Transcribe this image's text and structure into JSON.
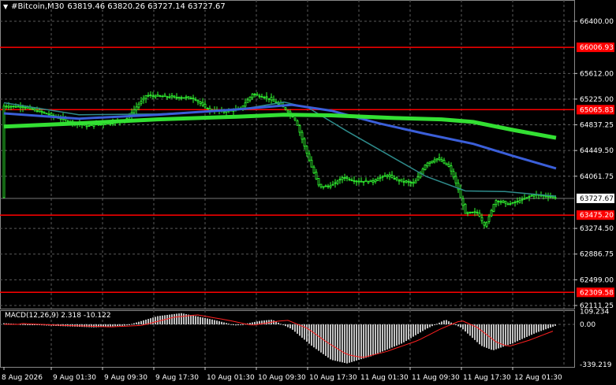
{
  "header": {
    "symbol": "#Bitcoin,M30",
    "ohlc": "63819.46 63820.26 63727.14 63727.67"
  },
  "price_axis": {
    "ticks": [
      "66400.00",
      "65612.00",
      "65225.00",
      "64837.25",
      "64449.50",
      "64061.75",
      "63274.50",
      "62886.75",
      "62499.00",
      "62111.25"
    ],
    "labels": [
      {
        "text": "66006.93",
        "kind": "level"
      },
      {
        "text": "65065.83",
        "kind": "level"
      },
      {
        "text": "63727.67",
        "kind": "current"
      },
      {
        "text": "63475.20",
        "kind": "level"
      },
      {
        "text": "62309.58",
        "kind": "level"
      }
    ]
  },
  "macd": {
    "label": "MACD(12,26,9) 2.318 -10.122",
    "ticks": [
      "109.234",
      "0.00",
      "-339.219"
    ]
  },
  "time_axis": [
    "8 Aug 2026",
    "9 Aug 01:30",
    "9 Aug 09:30",
    "9 Aug 17:30",
    "10 Aug 01:30",
    "10 Aug 09:30",
    "10 Aug 17:30",
    "11 Aug 01:30",
    "11 Aug 09:30",
    "11 Aug 17:30",
    "12 Aug 01:30"
  ],
  "colors": {
    "background": "#000000",
    "grid": "#5a5a5a",
    "candle": "#33ff33",
    "level_line": "#ff0000",
    "ma_green": "#33e033",
    "ma_blue": "#3b5fd9",
    "ma_teal": "#2e8b8b",
    "macd_hist": "#c0c0c0",
    "macd_signal": "#ff2020"
  },
  "chart_data": {
    "type": "line",
    "instrument": "#Bitcoin",
    "timeframe": "M30",
    "price_range": [
      62000,
      66600
    ],
    "levels": [
      66006.93,
      65065.83,
      63475.2,
      62309.58
    ],
    "current_price": 63727.67,
    "close_series": [
      {
        "t": "8 Aug 2026",
        "v": 65100
      },
      {
        "t": "9 Aug 01:30",
        "v": 64950
      },
      {
        "t": "9 Aug 09:30",
        "v": 64850
      },
      {
        "t": "9 Aug 17:30",
        "v": 65280
      },
      {
        "t": "10 Aug 01:30",
        "v": 65050
      },
      {
        "t": "10 Aug 09:30",
        "v": 65150
      },
      {
        "t": "10 Aug 17:30",
        "v": 63880
      },
      {
        "t": "11 Aug 01:30",
        "v": 63960
      },
      {
        "t": "11 Aug 09:30",
        "v": 64350
      },
      {
        "t": "11 Aug 17:30",
        "v": 63420
      },
      {
        "t": "12 Aug 01:30",
        "v": 63760
      }
    ],
    "macd_range": [
      -339.219,
      109.234
    ]
  }
}
